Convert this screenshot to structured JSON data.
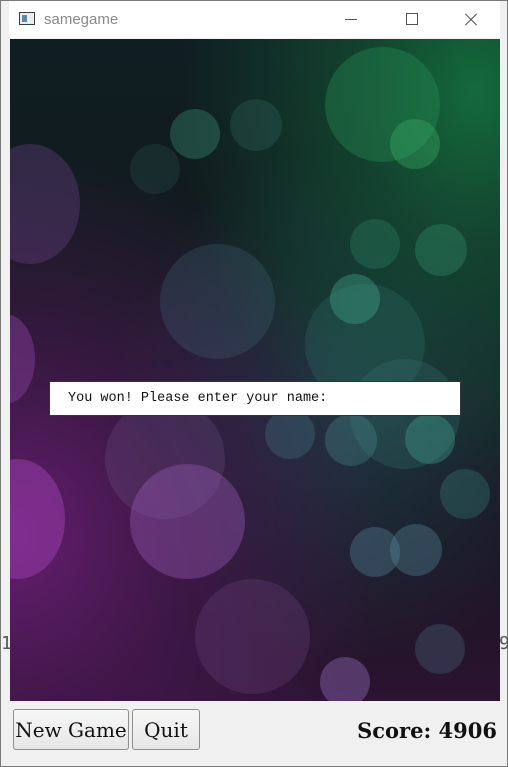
{
  "window": {
    "title": "samegame",
    "icon": "app-window-icon",
    "controls": [
      "minimize-icon",
      "maximize-icon",
      "close-icon"
    ]
  },
  "game": {
    "side_left": "1",
    "side_right": "9"
  },
  "dialog": {
    "prompt": "You won! Please enter your name:"
  },
  "toolbar": {
    "new_game_label": "New Game",
    "quit_label": "Quit",
    "score_text": "Score: 4906"
  },
  "colors": {
    "accent_green": "#1a7a4a",
    "accent_purple": "#7a2a8a",
    "dialog_bg": "#ffffff"
  }
}
